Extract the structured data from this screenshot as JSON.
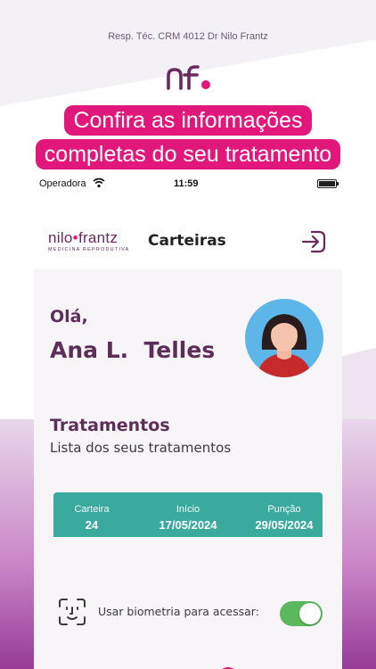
{
  "header": {
    "responsible": "Resp. Téc. CRM 4012 Dr Nilo Frantz",
    "logo_icon": "nf-logo"
  },
  "promo": {
    "line1": "Confira as informações",
    "line2": "completas do seu tratamento",
    "color": "#e2177b"
  },
  "status_bar": {
    "carrier": "Operadora",
    "time": "11:59",
    "wifi_icon": "wifi-icon",
    "battery_icon": "battery-icon"
  },
  "app_bar": {
    "brand_name_part1": "nilo",
    "brand_dot": "•",
    "brand_name_part2": "frantz",
    "brand_subtitle": "MEDICINA REPRODUTIVA",
    "title": "Carteiras",
    "logout_icon": "logout-icon"
  },
  "greeting": {
    "hello": "Olá,",
    "name": "Ana L.  Telles",
    "avatar_icon": "avatar"
  },
  "treatments": {
    "title": "Tratamentos",
    "subtitle": "Lista dos seus tratamentos",
    "columns": [
      {
        "header": "Carteira",
        "value": "24"
      },
      {
        "header": "Início",
        "value": "17/05/2024"
      },
      {
        "header": "Punção",
        "value": "29/05/2024"
      }
    ],
    "card_color": "#3aa99e"
  },
  "biometrics": {
    "label": "Usar biometria para acessar:",
    "enabled": true,
    "icon": "face-id-icon",
    "toggle_color": "#5bb85c"
  },
  "colors": {
    "brand_purple": "#5d2e5a",
    "accent_pink": "#e2177b"
  }
}
